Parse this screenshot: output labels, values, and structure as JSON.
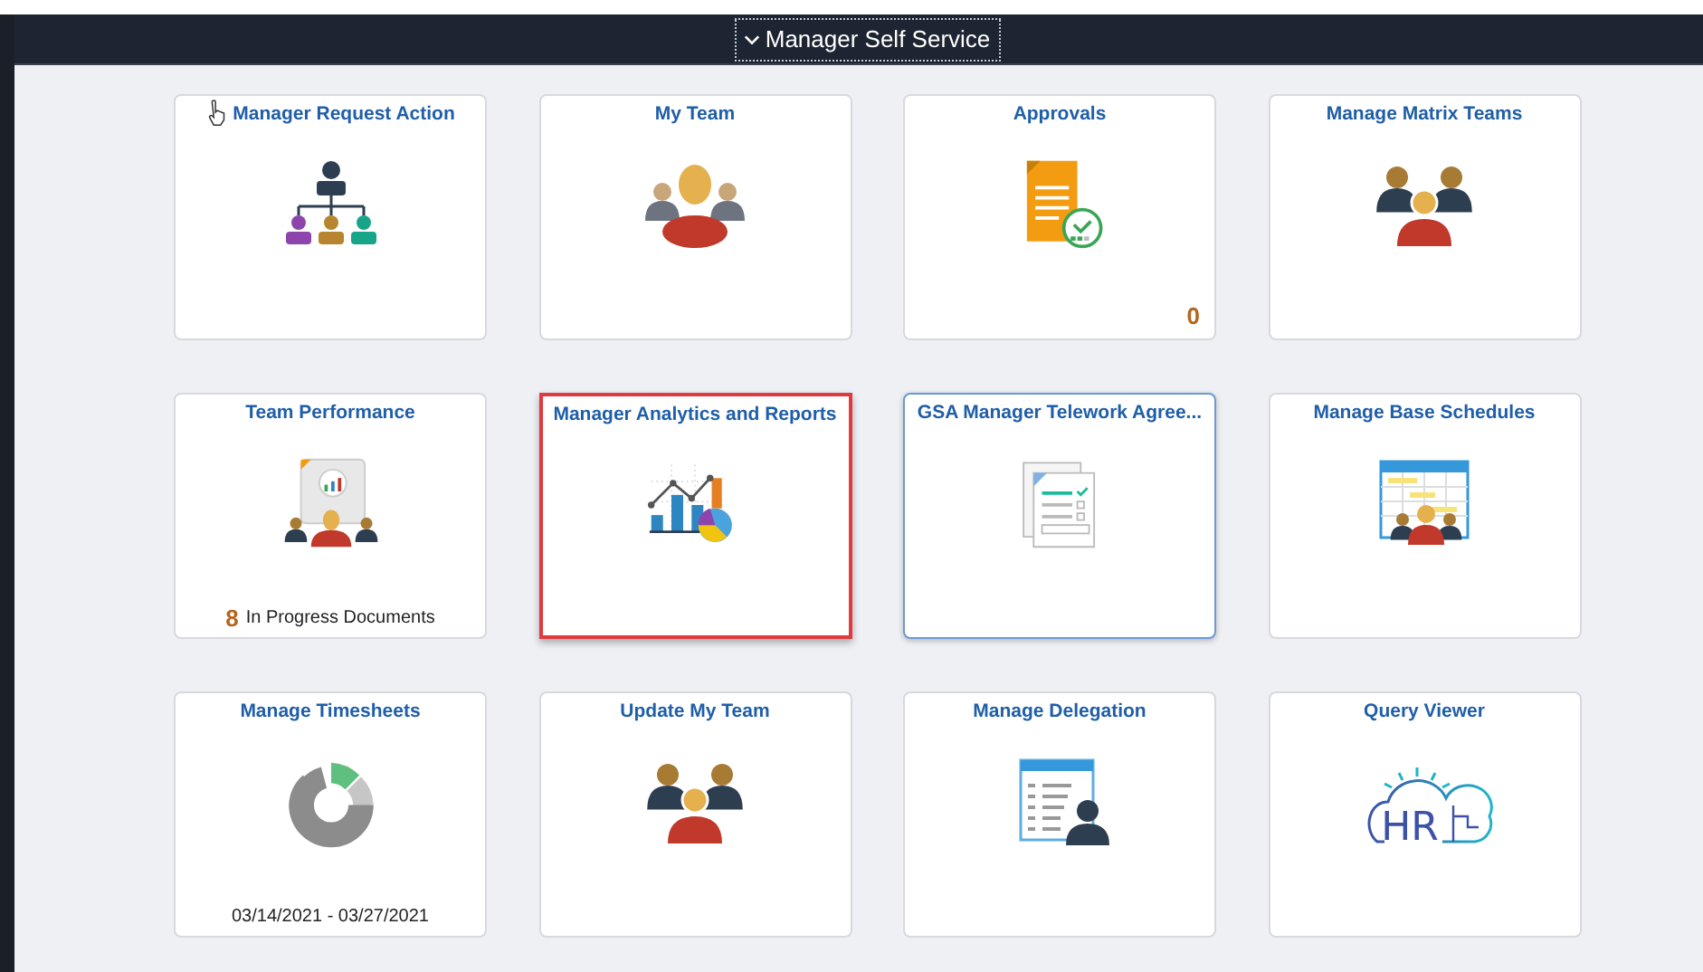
{
  "header": {
    "title": "Manager Self Service",
    "expanded": true
  },
  "tiles": [
    {
      "title": "Manager Request Action",
      "kind": "org-chart",
      "hovered": true,
      "highlighted": false,
      "focused": false
    },
    {
      "title": "My Team",
      "kind": "team",
      "hovered": false,
      "highlighted": false,
      "focused": false
    },
    {
      "title": "Approvals",
      "kind": "approval",
      "hovered": false,
      "highlighted": false,
      "focused": false,
      "footer": {
        "kind": "count",
        "count": "0"
      }
    },
    {
      "title": "Manage Matrix Teams",
      "kind": "group",
      "hovered": false,
      "highlighted": false,
      "focused": false
    },
    {
      "title": "Team Performance",
      "kind": "performance",
      "hovered": false,
      "highlighted": false,
      "focused": false,
      "footer": {
        "kind": "count-label",
        "count": "8",
        "label": "In Progress Documents"
      }
    },
    {
      "title": "Manager Analytics and Reports",
      "kind": "analytics",
      "hovered": false,
      "highlighted": true,
      "focused": false
    },
    {
      "title": "GSA Manager Telework Agree...",
      "kind": "agreement",
      "hovered": false,
      "highlighted": false,
      "focused": true
    },
    {
      "title": "Manage Base Schedules",
      "kind": "schedule",
      "hovered": false,
      "highlighted": false,
      "focused": false
    },
    {
      "title": "Manage Timesheets",
      "kind": "donut",
      "hovered": false,
      "highlighted": false,
      "focused": false,
      "footer": {
        "kind": "text",
        "text": "03/14/2021 - 03/27/2021"
      }
    },
    {
      "title": "Update My Team",
      "kind": "group",
      "hovered": false,
      "highlighted": false,
      "focused": false
    },
    {
      "title": "Manage Delegation",
      "kind": "delegation",
      "hovered": false,
      "highlighted": false,
      "focused": false
    },
    {
      "title": "Query Viewer",
      "kind": "cloud",
      "logo_text": "HR",
      "hovered": false,
      "highlighted": false,
      "focused": false
    }
  ]
}
